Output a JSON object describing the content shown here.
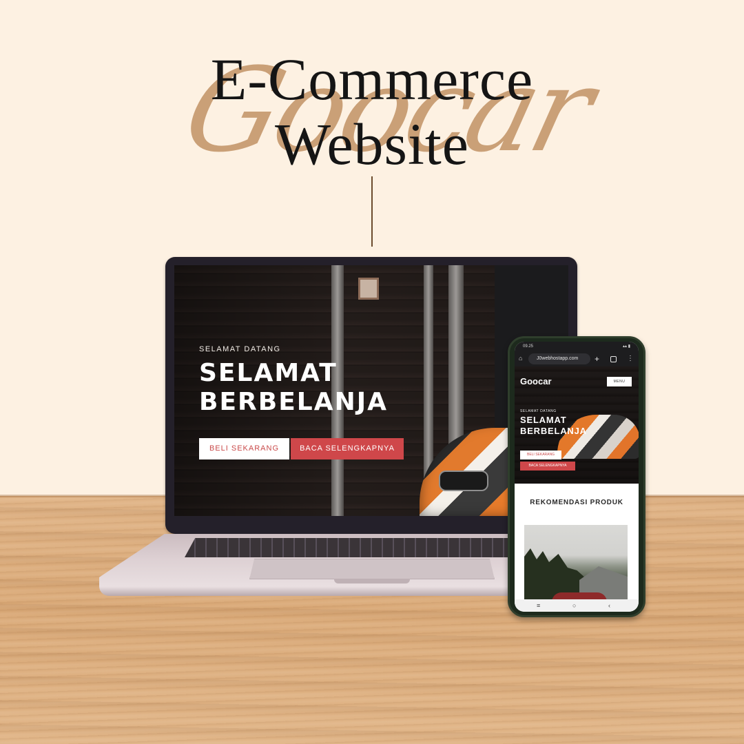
{
  "heading": {
    "script_word": "Goocar",
    "line1": "E-Commerce",
    "line2": "Website"
  },
  "laptop": {
    "welcome_small": "SELAMAT DATANG",
    "welcome_big": "SELAMAT BERBELANJA",
    "buy_button": "BELI SEKARANG",
    "read_button": "BACA SELENGKAPNYA"
  },
  "phone": {
    "status_time": "09.25",
    "url": "J0webhostapp.com",
    "logo": "Goocar",
    "menu_button": "MENU",
    "welcome_small": "SELAMAT DATANG",
    "welcome_big": "SELAMAT BERBELANJA",
    "buy_button": "BELI SEKARANG",
    "read_button": "BACA SELENGKAPNYA",
    "section_title": "REKOMENDASI PRODUK"
  },
  "colors": {
    "background": "#fdf1e2",
    "script_accent": "#caa077",
    "button_red": "#cf474a",
    "text_dark": "#151515"
  },
  "icons": {
    "home": "home-icon",
    "plus": "plus-icon",
    "tabs": "tabs-icon",
    "more": "kebab-icon",
    "recent": "recent-apps-icon",
    "nav_home": "nav-home-icon",
    "back": "back-icon"
  }
}
